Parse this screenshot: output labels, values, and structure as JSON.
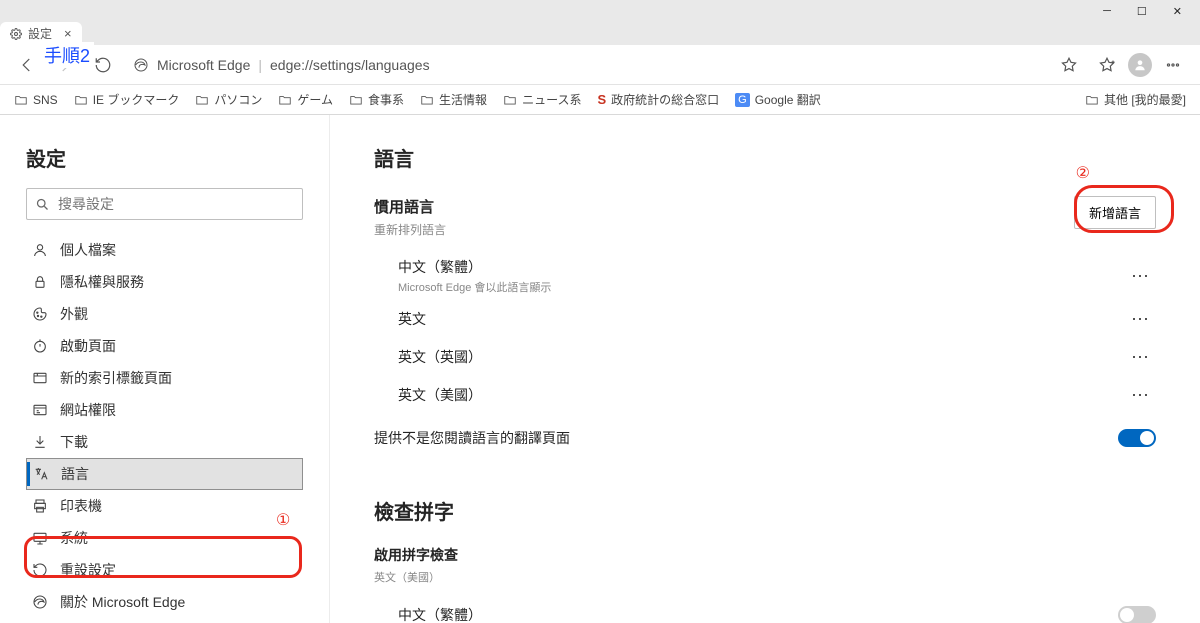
{
  "annotation": {
    "step_label": "手順2",
    "num1": "①",
    "num2": "②"
  },
  "tab": {
    "title": "設定"
  },
  "toolbar": {
    "app_name": "Microsoft Edge",
    "url": "edge://settings/languages"
  },
  "bookmarks": {
    "items": [
      "SNS",
      "IE ブックマーク",
      "パソコン",
      "ゲーム",
      "食事系",
      "生活情報",
      "ニュース系"
    ],
    "gov": "政府統計の総合窓口",
    "gtrans": "Google 翻訳",
    "overflow": "其他 [我的最愛]"
  },
  "sidebar": {
    "title": "設定",
    "search_placeholder": "搜尋設定",
    "items": [
      "個人檔案",
      "隱私權與服務",
      "外觀",
      "啟動頁面",
      "新的索引標籤頁面",
      "網站權限",
      "下載",
      "語言",
      "印表機",
      "系統",
      "重設設定",
      "關於 Microsoft Edge"
    ]
  },
  "main": {
    "title": "語言",
    "pref_title": "慣用語言",
    "pref_sub": "重新排列語言",
    "add_button": "新增語言",
    "langs": [
      {
        "name": "中文（繁體）",
        "sub": "Microsoft Edge 會以此語言顯示"
      },
      {
        "name": "英文"
      },
      {
        "name": "英文（英國）"
      },
      {
        "name": "英文（美國）"
      }
    ],
    "translate_label": "提供不是您閱讀語言的翻譯頁面",
    "spell_title": "檢查拼字",
    "spell_enable": "啟用拼字檢查",
    "spell_sub": "英文（美國）",
    "spell_lang": "中文（繁體）"
  }
}
